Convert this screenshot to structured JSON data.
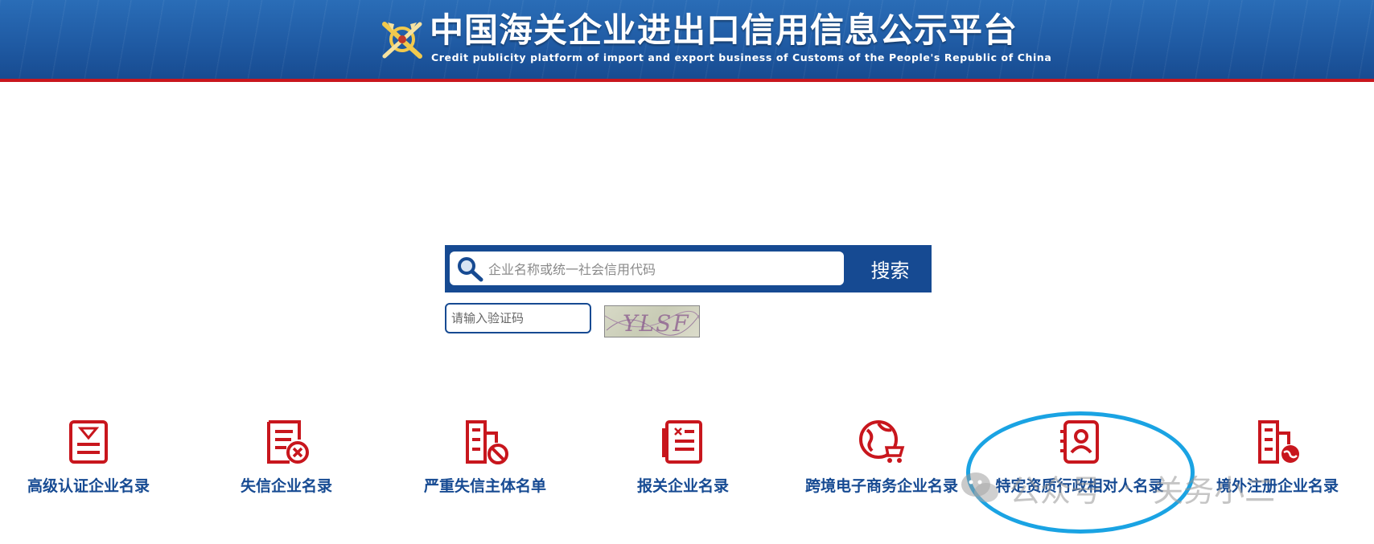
{
  "header": {
    "title": "中国海关企业进出口信用信息公示平台",
    "subtitle": "Credit publicity platform of import and export business of Customs of the People's Republic of China",
    "emblem_icon": "customs-emblem-icon"
  },
  "search": {
    "placeholder": "企业名称或统一社会信用代码",
    "button_label": "搜索",
    "icon": "search-icon"
  },
  "captcha": {
    "placeholder": "请输入验证码",
    "image_text": "YLSF"
  },
  "categories": [
    {
      "label": "高级认证企业名录",
      "icon": "certificate-icon"
    },
    {
      "label": "失信企业名录",
      "icon": "document-cancel-icon"
    },
    {
      "label": "严重失信主体名单",
      "icon": "building-prohibited-icon"
    },
    {
      "label": "报关企业名录",
      "icon": "customs-declaration-icon"
    },
    {
      "label": "跨境电子商务企业名录",
      "icon": "globe-cart-icon"
    },
    {
      "label": "特定资质行政相对人名录",
      "icon": "person-card-icon"
    },
    {
      "label": "境外注册企业名录",
      "icon": "building-globe-icon"
    }
  ],
  "watermark": {
    "text_left": "公众号",
    "separator": "·",
    "text_right": "关务小二"
  },
  "colors": {
    "banner_blue": "#1f5aa3",
    "banner_red_line": "#c8161d",
    "search_blue": "#164a92",
    "icon_red": "#c8161d",
    "label_blue": "#164a92",
    "highlight": "#1aa3e3"
  }
}
